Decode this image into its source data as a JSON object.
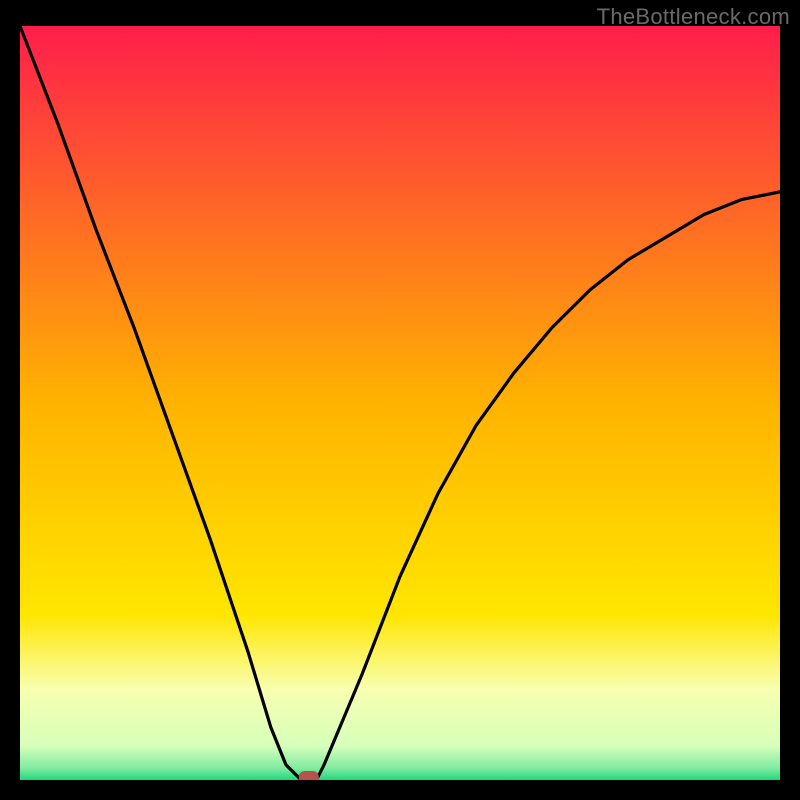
{
  "watermark": "TheBottleneck.com",
  "chart_data": {
    "type": "line",
    "title": "",
    "xlabel": "",
    "ylabel": "",
    "xlim": [
      0,
      100
    ],
    "ylim": [
      0,
      100
    ],
    "grid": false,
    "series": [
      {
        "name": "bottleneck-curve",
        "x": [
          0,
          5,
          10,
          15,
          20,
          25,
          30,
          33,
          35,
          37,
          39,
          40,
          45,
          50,
          55,
          60,
          65,
          70,
          75,
          80,
          85,
          90,
          95,
          100
        ],
        "y": [
          100,
          87,
          73,
          60,
          46,
          32,
          17,
          7,
          2,
          0,
          0,
          2,
          14,
          27,
          38,
          47,
          54,
          60,
          65,
          69,
          72,
          75,
          77,
          78
        ]
      }
    ],
    "marker": {
      "x": 38,
      "y": 0,
      "color": "#b5524a"
    },
    "background_gradient": {
      "stops": [
        {
          "offset": 0.0,
          "color": "#ff1e4b"
        },
        {
          "offset": 0.5,
          "color": "#ffb300"
        },
        {
          "offset": 0.78,
          "color": "#ffe600"
        },
        {
          "offset": 0.88,
          "color": "#f8ffb0"
        },
        {
          "offset": 0.955,
          "color": "#d6ffba"
        },
        {
          "offset": 0.985,
          "color": "#7deaa0"
        },
        {
          "offset": 1.0,
          "color": "#1ed97a"
        }
      ]
    }
  }
}
